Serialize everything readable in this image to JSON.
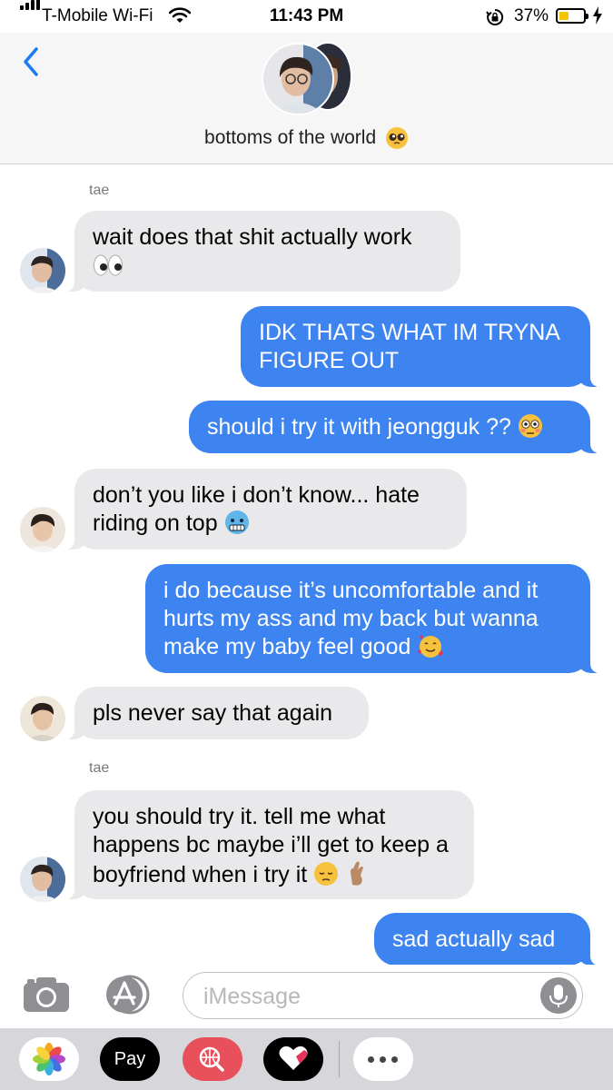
{
  "status": {
    "carrier": "T-Mobile Wi-Fi",
    "time": "11:43 PM",
    "battery": "37%",
    "battery_level": 0.37
  },
  "header": {
    "back_label": "",
    "group_name": "bottoms of the world",
    "group_emoji": "pleading-face"
  },
  "messages": [
    {
      "direction": "in",
      "sender": "tae",
      "text": "wait does that shit actually work",
      "emoji": [
        "eyes"
      ]
    },
    {
      "direction": "out",
      "text": "IDK THATS WHAT IM TRYNA FIGURE OUT"
    },
    {
      "direction": "out",
      "text": "should i try it with jeongguk ??",
      "emoji": [
        "flushed-face"
      ]
    },
    {
      "direction": "in",
      "text": "don’t you like i don’t know... hate riding on top",
      "emoji": [
        "cold-face"
      ]
    },
    {
      "direction": "out",
      "text": "i do because it’s uncomfortable and it hurts my ass and my back but wanna make my baby feel good",
      "emoji": [
        "smiling-face-with-hearts"
      ]
    },
    {
      "direction": "in",
      "text": "pls never say that again"
    },
    {
      "direction": "in",
      "sender": "tae",
      "text": "you should try it. tell me what happens bc maybe i’ll get to keep a boyfriend when i try it",
      "emoji": [
        "pensive-face",
        "crossed-fingers"
      ]
    },
    {
      "direction": "out",
      "text": "sad actually sad"
    }
  ],
  "input": {
    "placeholder": "iMessage"
  },
  "apps": {
    "apple_pay_label": "Pay"
  },
  "colors": {
    "outgoing_bubble": "#3d84f1",
    "incoming_bubble": "#e9e9eb",
    "accent": "#1a7cf5"
  }
}
